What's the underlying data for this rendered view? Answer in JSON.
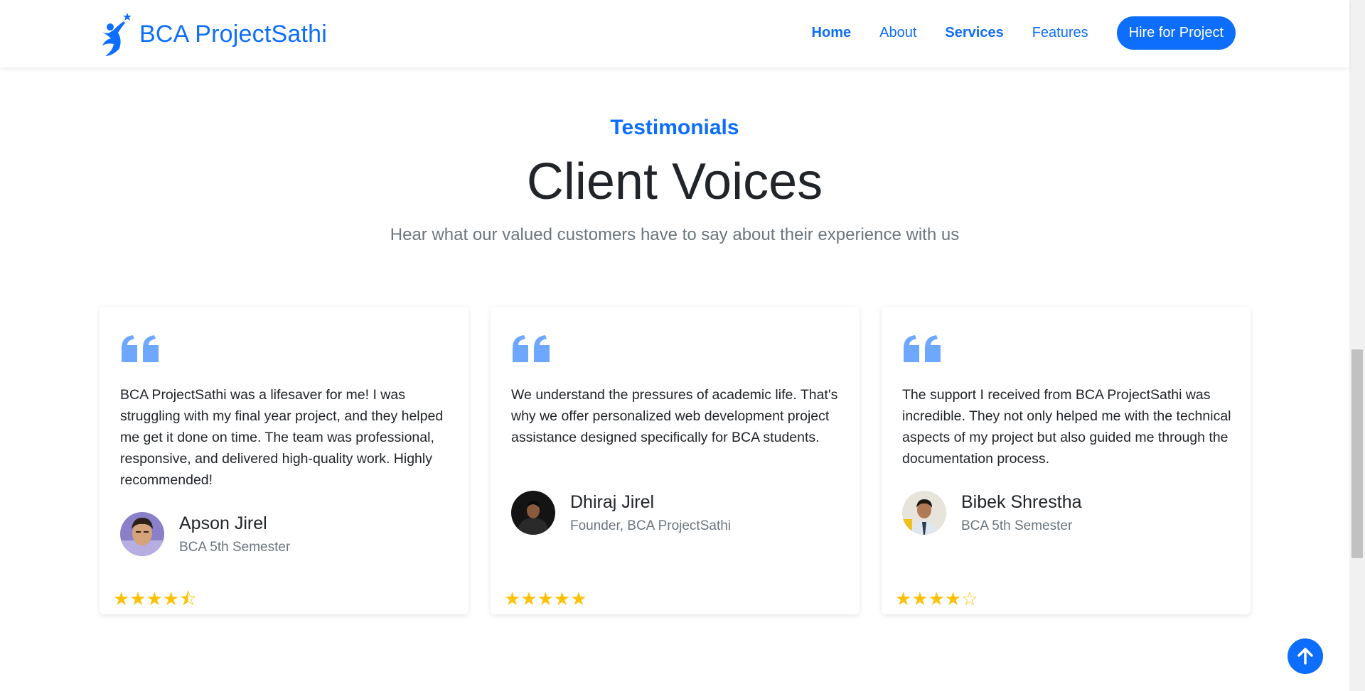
{
  "nav": {
    "brand": "BCA ProjectSathi",
    "links": [
      "Home",
      "About",
      "Services",
      "Features"
    ],
    "cta": "Hire for Project"
  },
  "section": {
    "eyebrow": "Testimonials",
    "title": "Client Voices",
    "subtitle": "Hear what our valued customers have to say about their experience with us"
  },
  "testimonials": [
    {
      "text": "BCA ProjectSathi was a lifesaver for me! I was struggling with my final year project, and they helped me get it done on time. The team was professional, responsive, and delivered high-quality work. Highly recommended!",
      "name": "Apson Jirel",
      "role": "BCA 5th Semester",
      "stars": "★★★★⯪",
      "rating": 4.5
    },
    {
      "text": "We understand the pressures of academic life. That's why we offer personalized web development project assistance designed specifically for BCA students.",
      "name": "Dhiraj Jirel",
      "role": "Founder, BCA ProjectSathi",
      "stars": "★★★★★",
      "rating": 5
    },
    {
      "text": "The support I received from BCA ProjectSathi was incredible. They not only helped me with the technical aspects of my project but also guided me through the documentation process.",
      "name": "Bibek Shrestha",
      "role": "BCA 5th Semester",
      "stars": "★★★★☆",
      "rating": 4
    }
  ],
  "colors": {
    "primary": "#0d6efd",
    "quote": "#6ea8fe",
    "star": "#ffc107",
    "muted": "#6c757d"
  },
  "icons": {
    "logo": "person-star-logo-icon",
    "quote": "quote-icon",
    "back_to_top": "arrow-up-icon"
  }
}
